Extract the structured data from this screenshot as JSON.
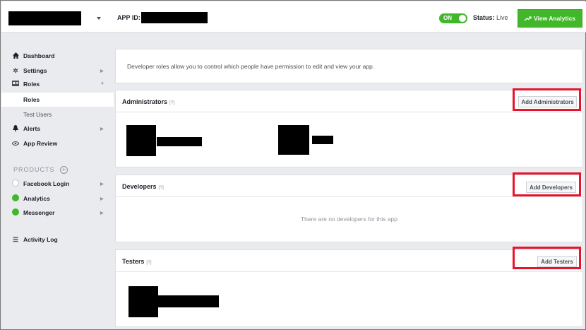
{
  "topbar": {
    "app_id_label": "APP ID:",
    "toggle_label": "ON",
    "status_label": "Status:",
    "status_value": "Live",
    "view_analytics_label": "View Analytics",
    "view_analytics_icon": "trend-up-icon"
  },
  "sidebar": {
    "items": [
      {
        "label": "Dashboard",
        "icon": "home-icon"
      },
      {
        "label": "Settings",
        "icon": "gear-icon"
      },
      {
        "label": "Roles",
        "icon": "id-card-icon"
      },
      {
        "label": "Roles"
      },
      {
        "label": "Test Users"
      },
      {
        "label": "Alerts",
        "icon": "bell-icon"
      },
      {
        "label": "App Review",
        "icon": "eye-icon"
      }
    ],
    "products_heading": "PRODUCTS",
    "products": [
      {
        "label": "Facebook Login",
        "status": "incomplete"
      },
      {
        "label": "Analytics",
        "status": "active"
      },
      {
        "label": "Messenger",
        "status": "active"
      }
    ],
    "activity_log": "Activity Log"
  },
  "main": {
    "intro": "Developer roles allow you to control which people have permission to edit and view your app.",
    "administrators": {
      "title": "Administrators",
      "help": "[?]",
      "button": "Add Administrators"
    },
    "developers": {
      "title": "Developers",
      "help": "[?]",
      "button": "Add Developers",
      "empty": "There are no developers for this app"
    },
    "testers": {
      "title": "Testers",
      "help": "[?]",
      "button": "Add Testers"
    }
  },
  "colors": {
    "accent_green": "#42b72a",
    "highlight_red": "#e8132c",
    "background": "#e9ebee"
  }
}
